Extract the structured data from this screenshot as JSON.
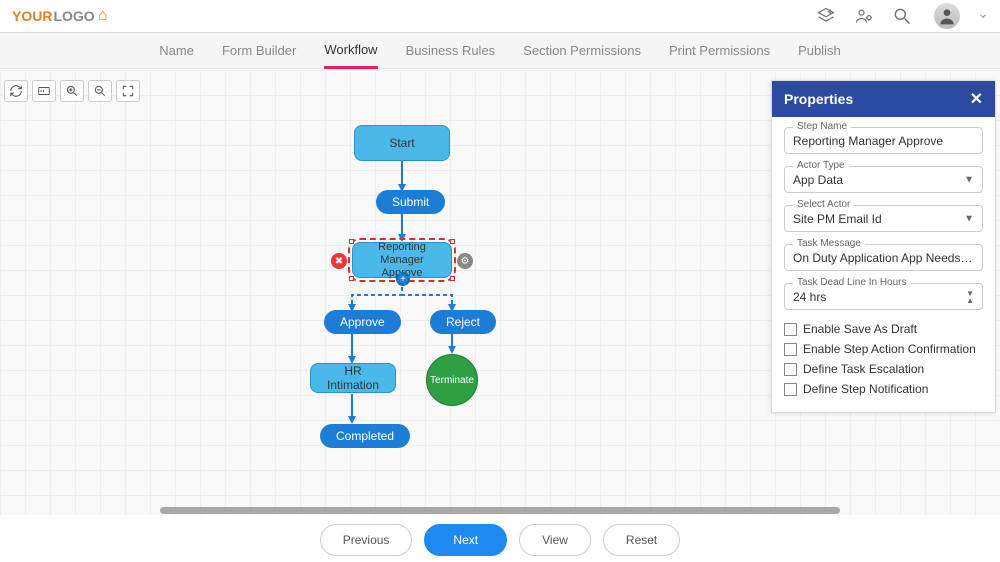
{
  "logo": {
    "part1": "YOUR",
    "part2": "LOGO"
  },
  "tabs": [
    {
      "label": "Name"
    },
    {
      "label": "Form Builder"
    },
    {
      "label": "Workflow",
      "active": true
    },
    {
      "label": "Business Rules"
    },
    {
      "label": "Section Permissions"
    },
    {
      "label": "Print Permissions"
    },
    {
      "label": "Publish"
    }
  ],
  "flow": {
    "start": "Start",
    "submit": "Submit",
    "reporting": "Reporting Manager Approve",
    "approve": "Approve",
    "reject": "Reject",
    "hr": "HR Intimation",
    "terminate": "Terminate",
    "completed": "Completed"
  },
  "properties": {
    "title": "Properties",
    "step_name_label": "Step Name",
    "step_name": "Reporting Manager Approve",
    "actor_type_label": "Actor Type",
    "actor_type": "App Data",
    "select_actor_label": "Select Actor",
    "select_actor": "Site PM Email Id",
    "task_message_label": "Task Message",
    "task_message": "On Duty Application App Needs Acti...",
    "deadline_label": "Task Dead Line In Hours",
    "deadline": "24 hrs",
    "chk1": "Enable Save As Draft",
    "chk2": "Enable Step Action Confirmation",
    "chk3": "Define Task Escalation",
    "chk4": "Define Step Notification"
  },
  "footer": {
    "previous": "Previous",
    "next": "Next",
    "view": "View",
    "reset": "Reset"
  }
}
